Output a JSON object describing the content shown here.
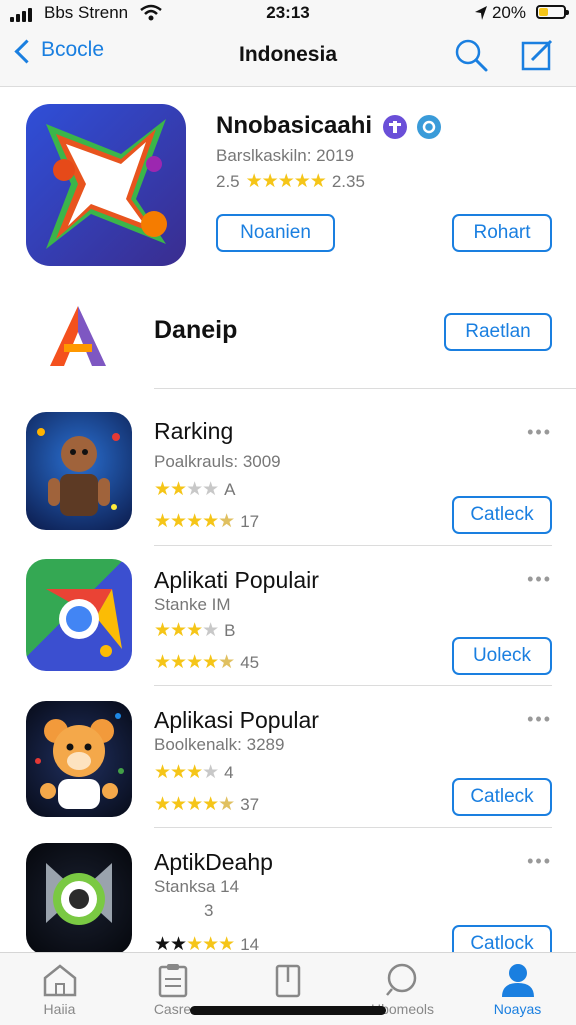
{
  "status_bar": {
    "carrier": "Bbs Strenn",
    "time": "23:13",
    "battery": "20%"
  },
  "nav": {
    "back_label": "Bcocle",
    "title": "Indonesia",
    "search_icon": "search-icon",
    "compose_icon": "compose-icon"
  },
  "featured": {
    "name": "Nnobasicaahi",
    "subtitle": "Barslkaskiln: 2019",
    "rating_text": "2.5",
    "rating_count": "2.35",
    "button_left": "Noanien",
    "button_right": "Rohart"
  },
  "apps": [
    {
      "name": "Daneip",
      "button": "Raetlan"
    },
    {
      "name": "Rarking",
      "meta": "Poalkrauls: 3009",
      "line1_text": "A",
      "line2_text": "17",
      "button": "Catleck"
    },
    {
      "name": "Aplikati Populair",
      "meta": "Stanke IM",
      "line1_text": "B",
      "line2_text": "45",
      "button": "Uoleck"
    },
    {
      "name": "Aplikasi Popular",
      "meta": "Boolkenalk: 3289",
      "line1_text": "4",
      "line2_text": "37",
      "button": "Catleck"
    },
    {
      "name": "AptikDeahp",
      "meta": "Stanksa 14",
      "line1_text": "3",
      "line2_text": "14",
      "button": "Catlock"
    }
  ],
  "tabs": [
    {
      "label": "Haiia",
      "icon": "home-icon"
    },
    {
      "label": "Casre",
      "icon": "clipboard-icon"
    },
    {
      "label": "",
      "icon": "card-icon"
    },
    {
      "label": "Hbomeols",
      "icon": "search-icon"
    },
    {
      "label": "Noayas",
      "icon": "person-icon",
      "active": true
    }
  ],
  "colors": {
    "accent": "#1a7fe0",
    "star": "#f5c518",
    "bar": "#f7f7f7"
  }
}
